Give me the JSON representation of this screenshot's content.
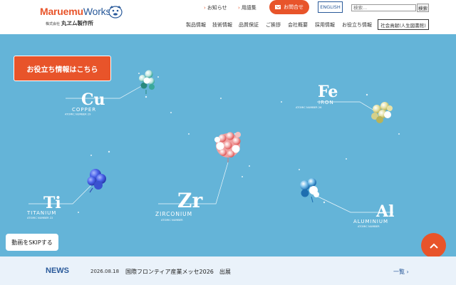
{
  "header": {
    "logo": {
      "main_m": "Maruemu",
      "main_rest": "Works",
      "company_prefix": "株式会社",
      "company_name": "丸ヱム製作所"
    },
    "util_links": [
      {
        "label": "お知らせ"
      },
      {
        "label": "用語集"
      }
    ],
    "contact_label": "お問合せ",
    "english_label": "ENGLISH",
    "search": {
      "placeholder": "検索...",
      "button_label": "検索"
    },
    "nav": [
      "製品情報",
      "技術情報",
      "品質保証",
      "ご挨拶",
      "会社概要",
      "採用情報",
      "お役立ち情報"
    ],
    "csr_label": "社会貢献(人生図書館)"
  },
  "hero": {
    "useful_button": "お役立ち情報はこちら",
    "skip_button": "動画をSKIPする",
    "elements": [
      {
        "symbol": "Cu",
        "name": "COPPER",
        "number": "ATOMIC NUMBER 29",
        "colors": [
          "#3aa89a",
          "#ffffff"
        ]
      },
      {
        "symbol": "Fe",
        "name": "IRON",
        "number": "ATOMIC NUMBER 26",
        "colors": [
          "#c8c86a",
          "#ffffff"
        ]
      },
      {
        "symbol": "Zr",
        "name": "ZIRCONIUM",
        "number": "ATOMIC NUMBER",
        "colors": [
          "#e86a6a",
          "#ffffff"
        ]
      },
      {
        "symbol": "Ti",
        "name": "TITANIUM",
        "number": "ATOMIC NUMBER 22",
        "colors": [
          "#3a5ae0",
          "#7a9aff"
        ]
      },
      {
        "symbol": "Al",
        "name": "ALUMINIUM",
        "number": "ATOMIC NUMBER",
        "colors": [
          "#2a8ac8",
          "#ffffff"
        ]
      }
    ],
    "colors": {
      "background": "#64b4d8",
      "accent": "#e8542a"
    }
  },
  "news": {
    "label": "NEWS",
    "date": "2026.08.18",
    "title": "国際フロンティア産業メッセ2026　出展",
    "more": "一覧"
  },
  "icons": {
    "contact": "mail-icon",
    "scroll_top": "chevron-up-icon",
    "more": "chevron-right-icon"
  }
}
